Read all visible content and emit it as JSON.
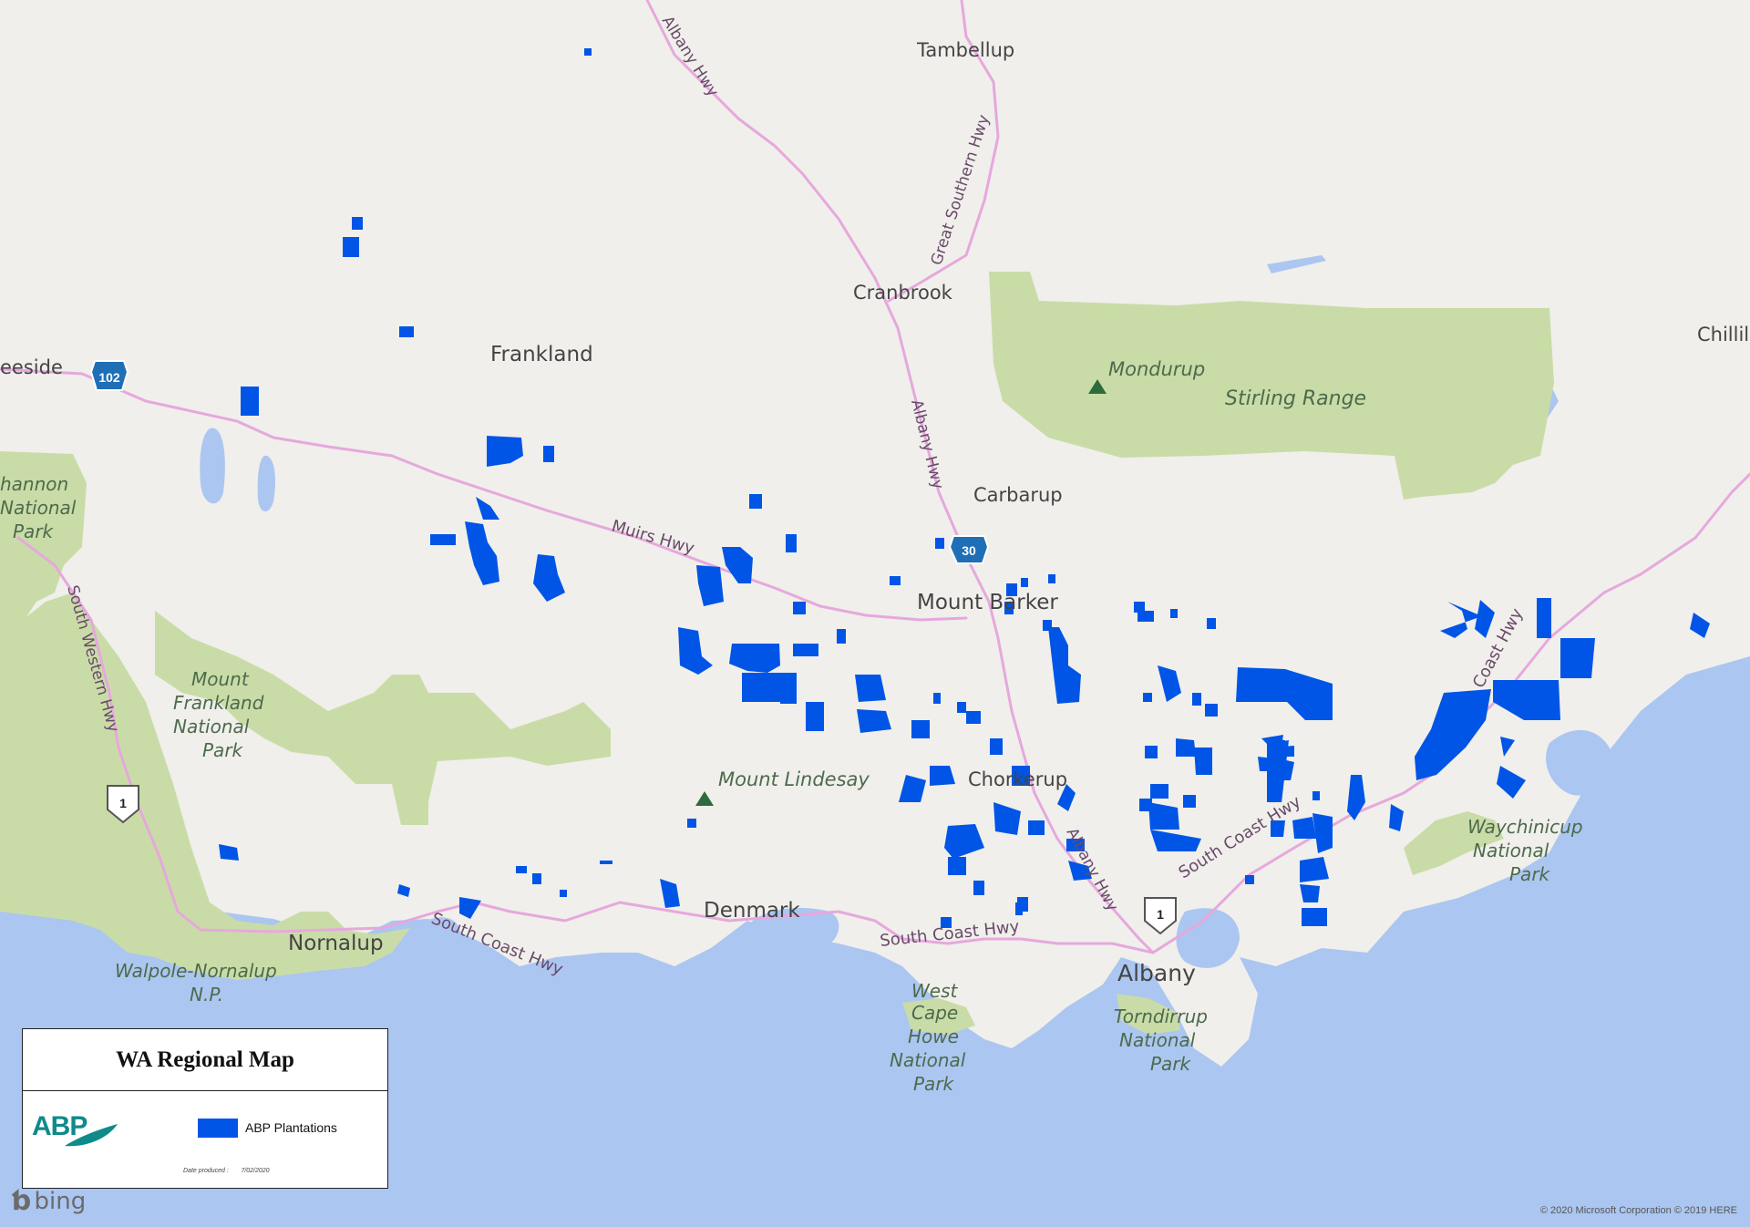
{
  "map": {
    "places": [
      "Tambellup",
      "Cranbrook",
      "Frankland",
      "Carbarup",
      "Mount Barker",
      "Denmark",
      "Nornalup",
      "Albany",
      "Chorkerup",
      "eeside",
      "Chillil"
    ],
    "parks": [
      "Mondurup",
      "Stirling Range",
      "Mount Lindesay",
      "Walpole-Nornalup",
      "N.P.",
      "West",
      "Cape",
      "Howe",
      "National",
      "Park",
      "Torndirrup",
      "National",
      "Park",
      "Waychinicup",
      "National",
      "Park",
      "Mount",
      "Frankland",
      "National",
      "Park",
      "hannon",
      "National",
      "Park"
    ],
    "roads": [
      "Albany Hwy",
      "Great Southern Hwy",
      "Muirs Hwy",
      "Albany Hwy",
      "South Coast Hwy",
      "South Coast Hwy",
      "South Coast Hwy",
      "South Coast Hwy",
      "South Western Hwy",
      "Coast Hwy",
      "Albany Hwy"
    ],
    "shields": [
      "102",
      "30",
      "1",
      "1",
      "1"
    ]
  },
  "legend": {
    "title": "WA Regional Map",
    "logo": "ABP",
    "item_label": "ABP Plantations",
    "date_label": "Date produced :",
    "date_value": "7/02/2020"
  },
  "attribution": {
    "bing": "bing",
    "copyright": "© 2020 Microsoft Corporation © 2019 HERE"
  },
  "colors": {
    "land": "#f0efeb",
    "water": "#abc6f0",
    "park": "#c9dca7",
    "road": "#e8a6e0",
    "plantation": "#0055e6"
  }
}
